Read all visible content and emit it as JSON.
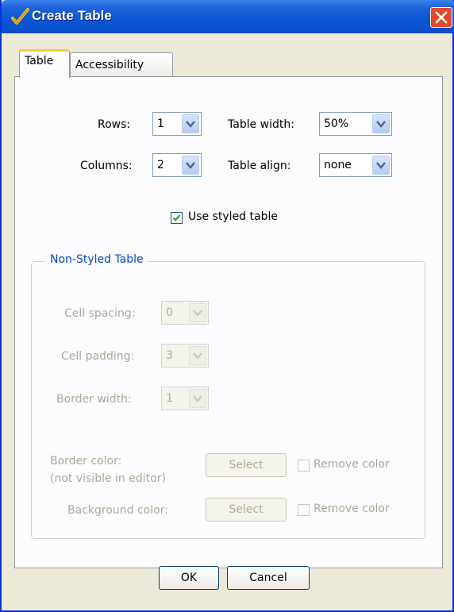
{
  "window": {
    "title": "Create Table"
  },
  "tabs": [
    {
      "label": "Table",
      "active": true
    },
    {
      "label": "Accessibility",
      "active": false
    }
  ],
  "table": {
    "rows_label": "Rows:",
    "rows_value": "1",
    "columns_label": "Columns:",
    "columns_value": "2",
    "table_width_label": "Table width:",
    "table_width_value": "50%",
    "table_align_label": "Table align:",
    "table_align_value": "none",
    "use_styled_label": "Use styled table",
    "use_styled_checked": true
  },
  "non_styled": {
    "legend": "Non-Styled Table",
    "cell_spacing_label": "Cell spacing:",
    "cell_spacing_value": "0",
    "cell_padding_label": "Cell padding:",
    "cell_padding_value": "3",
    "border_width_label": "Border width:",
    "border_width_value": "1",
    "border_color_label_line1": "Border color:",
    "border_color_label_line2": "(not visible in editor)",
    "background_color_label": "Background color:",
    "select_label": "Select",
    "remove_color_label": "Remove color"
  },
  "footer": {
    "ok_label": "OK",
    "cancel_label": "Cancel"
  },
  "colors": {
    "title_bar": "#0A55D7",
    "dialog_bg": "#ECE9D8",
    "legend_text": "#0046D5",
    "disabled_text": "#ACA899"
  }
}
